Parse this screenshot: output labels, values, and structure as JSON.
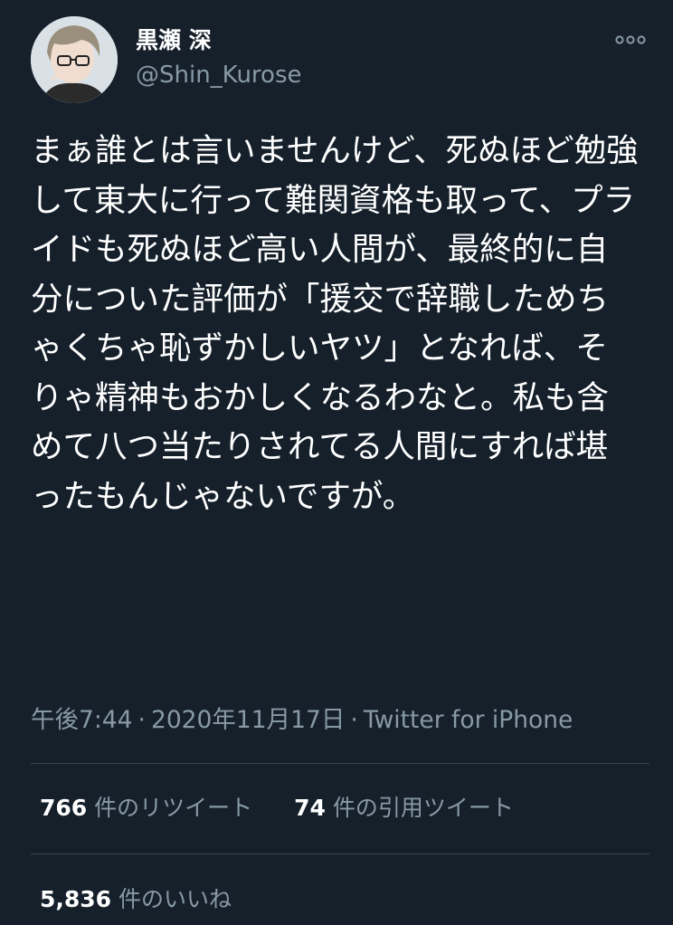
{
  "tweet": {
    "author": {
      "display_name": "黒瀬 深",
      "handle": "@Shin_Kurose",
      "avatar_icon": "avatar-icon"
    },
    "more_icon": "more-options-icon",
    "text": "まぁ誰とは言いませんけど、死ぬほど勉強して東大に行って難関資格も取って、プライドも死ぬほど高い人間が、最終的に自分についた評価が「援交で辞職しためちゃくちゃ恥ずかしいヤツ」となれば、そりゃ精神もおかしくなるわなと。私も含めて八つ当たりされてる人間にすれば堪ったもんじゃないですが。",
    "time": "午後7:44",
    "separator": "·",
    "date": "2020年11月17日",
    "source": "Twitter for iPhone",
    "retweets": {
      "count": "766",
      "label": "件のリツイート"
    },
    "quotes": {
      "count": "74",
      "label": "件の引用ツイート"
    },
    "likes": {
      "count": "5,836",
      "label": "件のいいね"
    }
  },
  "colors": {
    "background": "#15202b",
    "primary_text": "#ffffff",
    "secondary_text": "#8899a6",
    "divider": "#38444d"
  }
}
